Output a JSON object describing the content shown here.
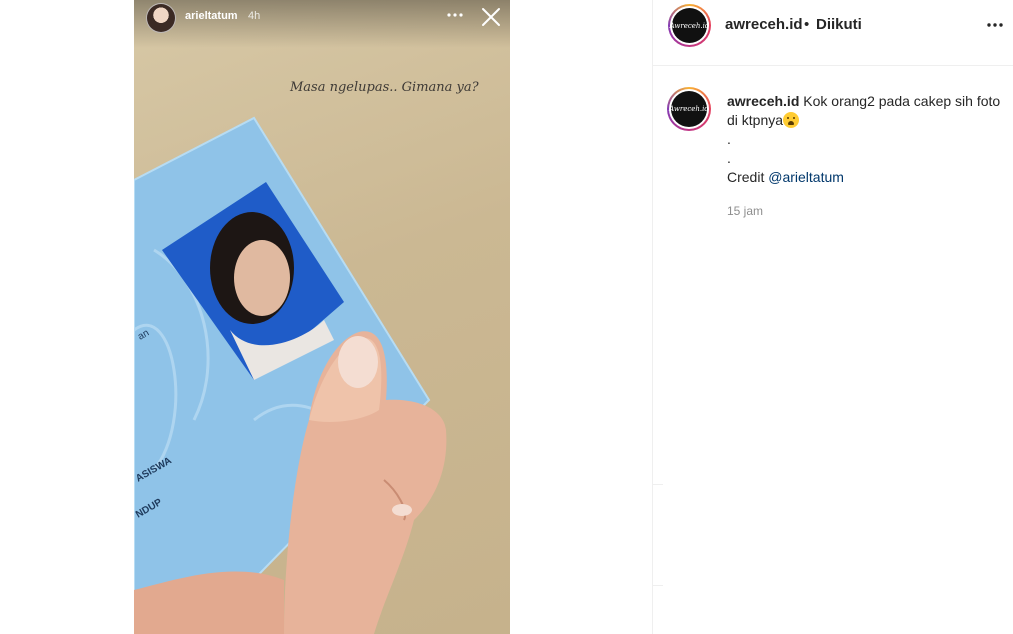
{
  "story": {
    "username": "arieltatum",
    "time": "4h",
    "caption": "Masa ngelupas.. Gimana ya?",
    "avatar_icon": "profile-avatar",
    "more_icon": "more-dots-icon",
    "close_icon": "close-icon"
  },
  "post": {
    "header": {
      "username": "awreceh.id",
      "separator": "•",
      "follow_status": "Diikuti",
      "more_icon": "more-dots-icon"
    },
    "logo_text": "Awreceh.id",
    "caption": {
      "username": "awreceh.id",
      "text_line1": "Kok orang2 pada cakep sih foto di ktpnya",
      "emoji": "weeping-face-emoji",
      "dot1": ".",
      "dot2": ".",
      "credit_label": "Credit ",
      "credit_mention": "@arieltatum"
    },
    "time": "15 jam"
  },
  "colors": {
    "text": "#262626",
    "muted": "#8e8e8e",
    "mention": "#00376b",
    "story_bg": "#cbb893",
    "card": "#8fc3e8"
  }
}
